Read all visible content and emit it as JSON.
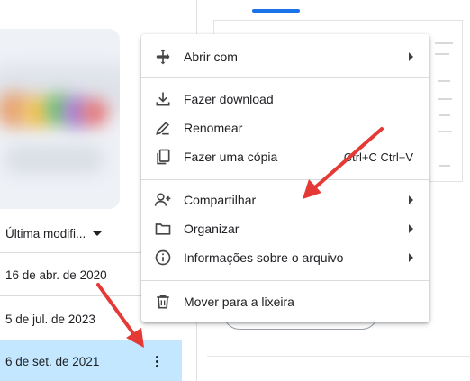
{
  "file_list": {
    "column_header": "Última modifi...",
    "rows": [
      {
        "date": "16 de abr. de 2020"
      },
      {
        "date": "5 de jul. de 2023"
      },
      {
        "date": "6 de set. de 2021"
      }
    ]
  },
  "context_menu": {
    "items": [
      {
        "label": "Abrir com",
        "icon": "move-icon",
        "submenu": true
      },
      {
        "label": "Fazer download",
        "icon": "download-icon"
      },
      {
        "label": "Renomear",
        "icon": "pencil-icon"
      },
      {
        "label": "Fazer uma cópia",
        "icon": "copy-icon",
        "shortcut": "Ctrl+C Ctrl+V"
      },
      {
        "label": "Compartilhar",
        "icon": "person-add-icon",
        "submenu": true
      },
      {
        "label": "Organizar",
        "icon": "folder-icon",
        "submenu": true
      },
      {
        "label": "Informações sobre o arquivo",
        "icon": "info-icon",
        "submenu": true
      },
      {
        "label": "Mover para a lixeira",
        "icon": "trash-icon"
      }
    ]
  },
  "annotation_color": "#e53935",
  "selection_color": "#c2e7ff",
  "accent_color": "#1a73e8"
}
